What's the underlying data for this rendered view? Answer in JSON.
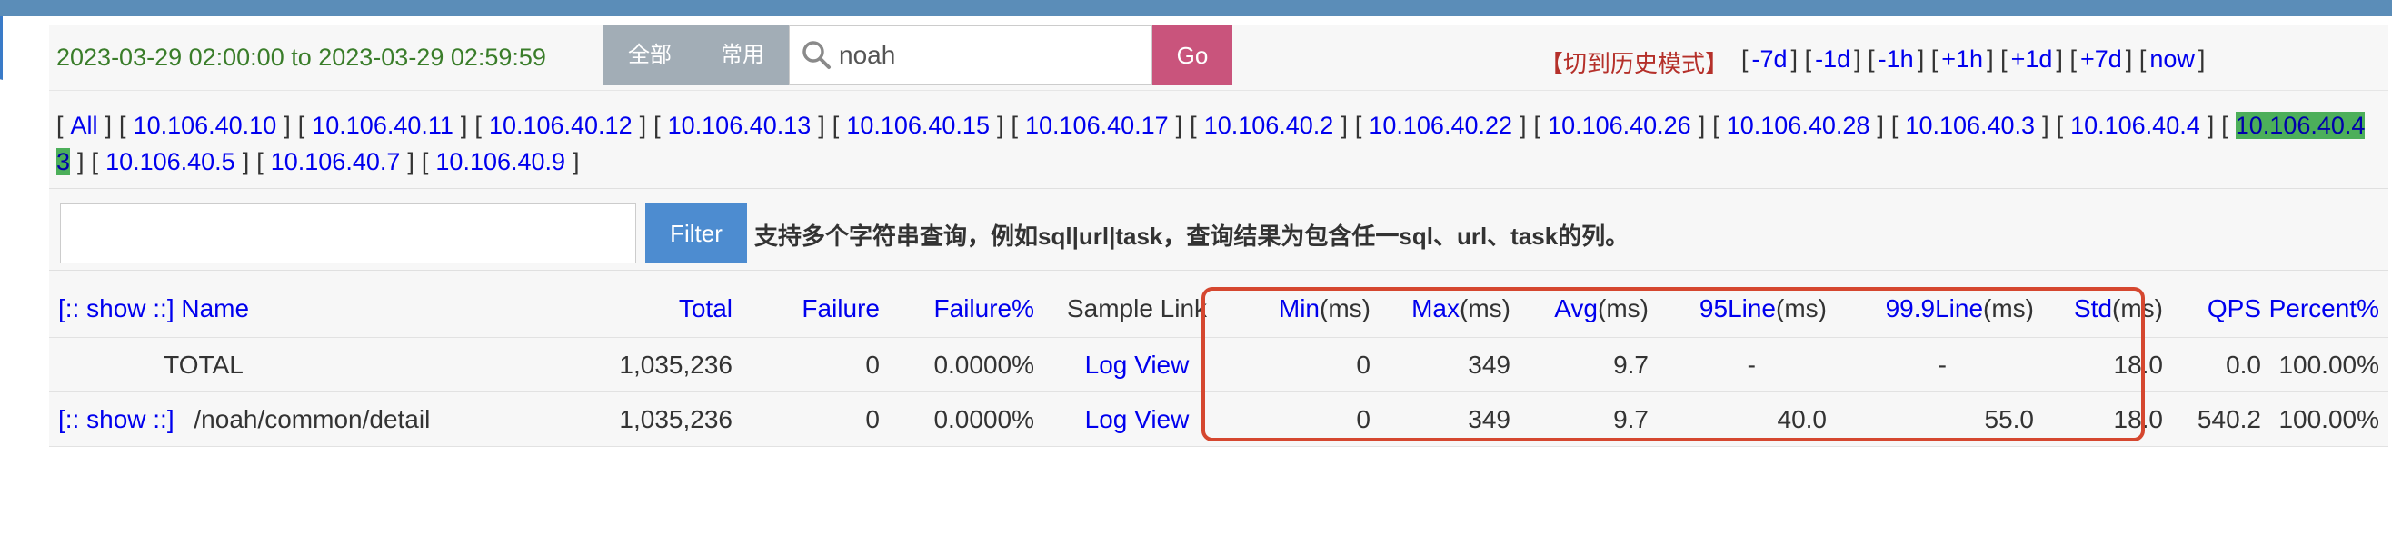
{
  "time_range": "2023-03-29 02:00:00 to 2023-03-29 02:59:59",
  "search": {
    "btn_all": "全部",
    "btn_common": "常用",
    "value": "noah",
    "go_label": "Go"
  },
  "history_mode": "【切到历史模式】",
  "time_nav": [
    "-7d",
    "-1d",
    "-1h",
    "+1h",
    "+1d",
    "+7d",
    "now"
  ],
  "ip_filter": {
    "all_label": "All",
    "ips": [
      "10.106.40.10",
      "10.106.40.11",
      "10.106.40.12",
      "10.106.40.13",
      "10.106.40.15",
      "10.106.40.17",
      "10.106.40.2",
      "10.106.40.22",
      "10.106.40.26",
      "10.106.40.28",
      "10.106.40.3",
      "10.106.40.4",
      "10.106.40.43",
      "10.106.40.5",
      "10.106.40.7",
      "10.106.40.9"
    ],
    "selected": "10.106.40.43"
  },
  "filter": {
    "button_label": "Filter",
    "hint": "支持多个字符串查询，例如sql|url|task，查询结果为包含任一sql、url、task的列。"
  },
  "table": {
    "show_label": "[:: show ::]",
    "headers": {
      "name": "Name",
      "total": "Total",
      "failure": "Failure",
      "failure_pct": "Failure%",
      "sample_link": "Sample Link",
      "min": "Min",
      "max": "Max",
      "avg": "Avg",
      "line95": "95Line",
      "line999": "99.9Line",
      "std": "Std",
      "ms_unit": "(ms)",
      "qps": "QPS",
      "percent": "Percent%"
    },
    "rows": [
      {
        "show": "",
        "name": "TOTAL",
        "total": "1,035,236",
        "failure": "0",
        "failure_pct": "0.0000%",
        "sample": "Log View",
        "min": "0",
        "max": "349",
        "avg": "9.7",
        "line95": "-",
        "line999": "-",
        "std": "18.0",
        "qps": "0.0",
        "percent": "100.00%"
      },
      {
        "show": "[:: show ::]",
        "name": "/noah/common/detail",
        "total": "1,035,236",
        "failure": "0",
        "failure_pct": "0.0000%",
        "sample": "Log View",
        "min": "0",
        "max": "349",
        "avg": "9.7",
        "line95": "40.0",
        "line999": "55.0",
        "std": "18.0",
        "qps": "540.2",
        "percent": "100.00%"
      }
    ]
  },
  "colors": {
    "top_bar": "#5b8db8",
    "time_text": "#3a7d2a",
    "go_button": "#c9547c",
    "filter_button": "#4d8cd0",
    "highlight_border": "#d5472f",
    "selected_ip": "#4caf5a"
  }
}
